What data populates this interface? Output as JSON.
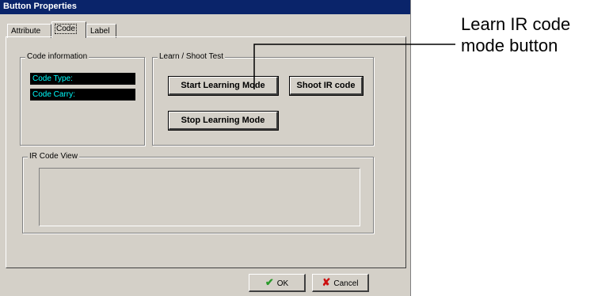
{
  "window": {
    "title": "Button Properties"
  },
  "tabs": [
    {
      "label": "Attribute"
    },
    {
      "label": "Code"
    },
    {
      "label": "Label"
    }
  ],
  "code_info": {
    "title": "Code information",
    "code_type_label": "Code Type:",
    "code_carry_label": "Code Carry:"
  },
  "learn_shoot": {
    "title": "Learn / Shoot Test",
    "start_learning_label": "Start Learning  Mode",
    "shoot_ir_label": "Shoot IR code",
    "stop_learning_label": "Stop Learning Mode"
  },
  "ir_code_view": {
    "title": "IR Code View"
  },
  "footer": {
    "ok_label": "OK",
    "cancel_label": "Cancel"
  },
  "callout": {
    "text": "Learn IR code mode button"
  },
  "icons": {
    "ok": "checkmark-icon",
    "cancel": "x-icon"
  },
  "colors": {
    "titlebar": "#0a246a",
    "window": "#d4d0c8",
    "field_bg": "#000000",
    "field_text": "#00ffff"
  }
}
